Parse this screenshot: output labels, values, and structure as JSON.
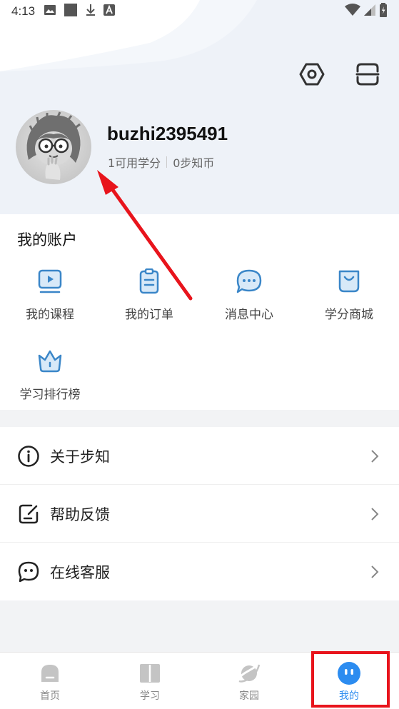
{
  "status_bar": {
    "time": "4:13",
    "icons_left": [
      "image-icon",
      "stop-icon",
      "download-icon",
      "font-icon"
    ],
    "icons_right": [
      "wifi-icon",
      "signal-icon",
      "battery-icon"
    ]
  },
  "header": {
    "settings_icon": "settings-hexagon-icon",
    "scan_icon": "scan-icon"
  },
  "profile": {
    "username": "buzhi2395491",
    "credits": "1可用学分",
    "coins": "0步知币"
  },
  "account": {
    "title": "我的账户",
    "items": [
      {
        "label": "我的课程",
        "icon": "course-play-icon"
      },
      {
        "label": "我的订单",
        "icon": "order-clipboard-icon"
      },
      {
        "label": "消息中心",
        "icon": "message-bubble-icon"
      },
      {
        "label": "学分商城",
        "icon": "shopping-bag-icon"
      },
      {
        "label": "学习排行榜",
        "icon": "crown-icon"
      }
    ]
  },
  "menu": {
    "items": [
      {
        "label": "关于步知",
        "icon": "info-circle-icon"
      },
      {
        "label": "帮助反馈",
        "icon": "feedback-edit-icon"
      },
      {
        "label": "在线客服",
        "icon": "chat-service-icon"
      }
    ]
  },
  "bottom_nav": {
    "items": [
      {
        "label": "首页",
        "icon": "home-icon",
        "active": false
      },
      {
        "label": "学习",
        "icon": "book-icon",
        "active": false
      },
      {
        "label": "家园",
        "icon": "planet-icon",
        "active": false
      },
      {
        "label": "我的",
        "icon": "mine-face-icon",
        "active": true
      }
    ]
  },
  "colors": {
    "accent": "#2c8cf0",
    "icon_blue": "#3a86c8",
    "annotation_red": "#e8141c"
  }
}
